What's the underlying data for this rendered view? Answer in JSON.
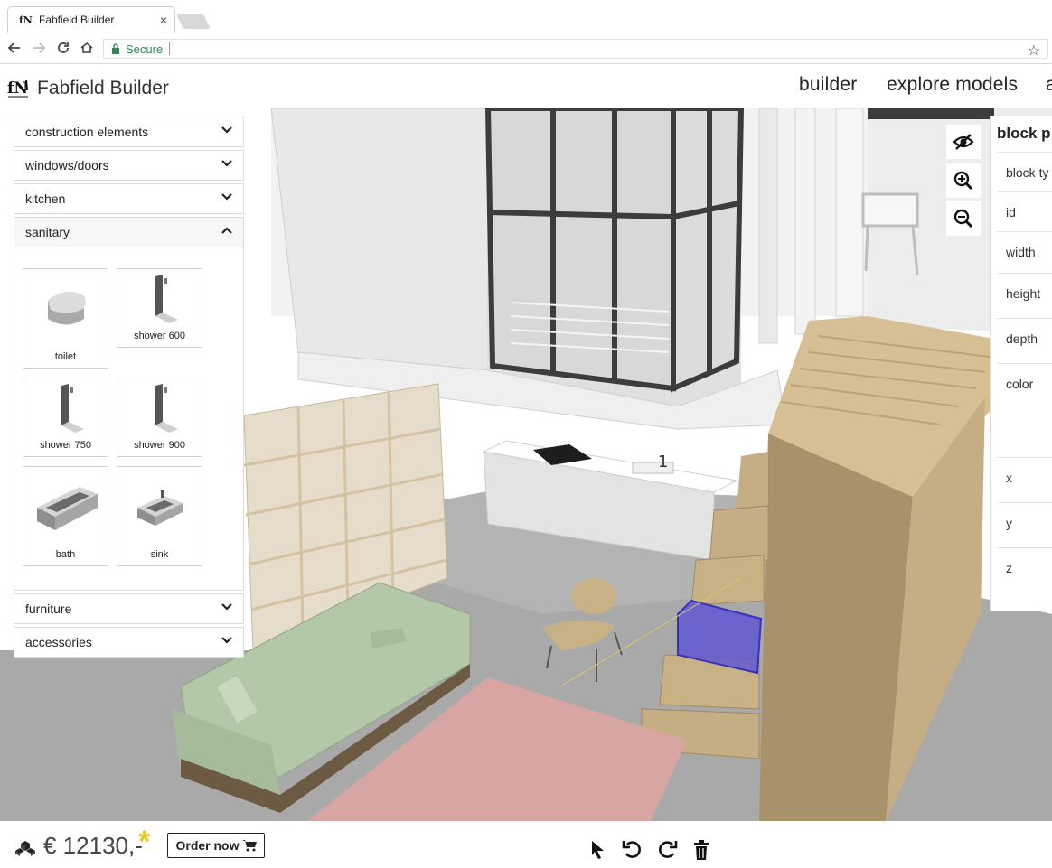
{
  "browser": {
    "tab_title": "Fabfield Builder",
    "close_glyph": "×",
    "secure_label": "Secure",
    "url": ""
  },
  "app": {
    "title": "Fabfield Builder",
    "nav": [
      {
        "label": "builder"
      },
      {
        "label": "explore models"
      },
      {
        "label": "a"
      }
    ]
  },
  "sidebar": {
    "sections": [
      {
        "label": "construction elements",
        "expanded": false
      },
      {
        "label": "windows/doors",
        "expanded": false
      },
      {
        "label": "kitchen",
        "expanded": false
      },
      {
        "label": "sanitary",
        "expanded": true
      },
      {
        "label": "furniture",
        "expanded": false
      },
      {
        "label": "accessories",
        "expanded": false
      }
    ],
    "sanitary_items": [
      {
        "label": "toilet",
        "icon": "toilet-icon"
      },
      {
        "label": "shower 600",
        "icon": "shower-icon"
      },
      {
        "label": "shower 750",
        "icon": "shower-icon"
      },
      {
        "label": "shower 900",
        "icon": "shower-icon"
      },
      {
        "label": "bath",
        "icon": "bath-icon"
      },
      {
        "label": "sink",
        "icon": "sink-icon"
      }
    ]
  },
  "properties": {
    "title": "block p",
    "fields": [
      {
        "label": "block ty"
      },
      {
        "label": "id"
      },
      {
        "label": "width"
      },
      {
        "label": "height"
      },
      {
        "label": "depth"
      },
      {
        "label": "color"
      },
      {
        "label": "x"
      },
      {
        "label": "y"
      },
      {
        "label": "z"
      }
    ]
  },
  "scene": {
    "stair_step_label": "1",
    "colors": {
      "wood": "#c6ae84",
      "sofa": "#b3c7a9",
      "rug": "#d7a6a2",
      "selection": "#5b52d6",
      "floor": "#a8a8a8"
    }
  },
  "footer": {
    "price": "€ 12130,-",
    "asterisk": "*",
    "order_label": "Order now",
    "tools": [
      "select-cursor-icon",
      "undo-icon",
      "redo-icon",
      "trash-icon"
    ]
  }
}
